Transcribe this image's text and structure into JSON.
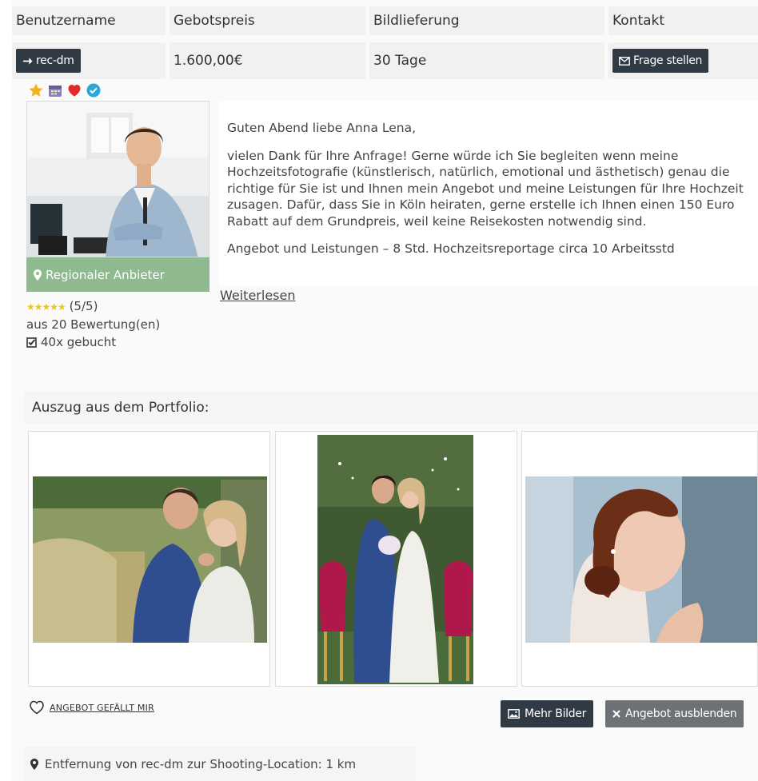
{
  "table": {
    "headers": [
      "Benutzername",
      "Gebotspreis",
      "Bildlieferung",
      "Kontakt"
    ],
    "username": "rec-dm",
    "price": "1.600,00€",
    "delivery": "30 Tage",
    "ask_label": "Frage stellen"
  },
  "badges": [
    "star-badge",
    "calendar-badge",
    "heart-badge",
    "verified-badge"
  ],
  "profile": {
    "region_label": "Regionaler Anbieter",
    "rating_text": "(5/5)",
    "reviews_text": "aus 20 Bewertung(en)",
    "booked_text": "40x gebucht"
  },
  "message": {
    "greeting": "Guten Abend liebe Anna Lena,",
    "body": "vielen Dank für Ihre Anfrage! Gerne würde ich Sie begleiten wenn meine Hochzeitsfotografie (künstlerisch, natürlich, emotional und ästhetisch) genau die richtige für Sie ist und Ihnen mein Angebot und meine Leistungen für Ihre Hochzeit zusagen. Dafür, dass Sie in Köln heiraten, gerne erstelle ich Ihnen einen 150 Euro Rabatt auf dem Grundpreis, weil keine Reisekosten notwendig sind.",
    "cut_line": "Angebot und Leistungen – 8 Std. Hochzeitsreportage circa 10 Arbeitsstd",
    "more_label": "Weiterlesen"
  },
  "portfolio": {
    "heading": "Auszug aus dem Portfolio:"
  },
  "actions": {
    "like_label": "ANGEBOT GEFÄLLT MIR",
    "more_images_label": "Mehr Bilder",
    "hide_label": "Angebot ausblenden"
  },
  "distance_text": "Entfernung von rec-dm zur Shooting-Location: 1 km",
  "colors": {
    "dark_button": "#2f3a45",
    "grey_button": "#6e7176",
    "region_green": "#8fb98f",
    "star_yellow": "#f1c40f"
  }
}
